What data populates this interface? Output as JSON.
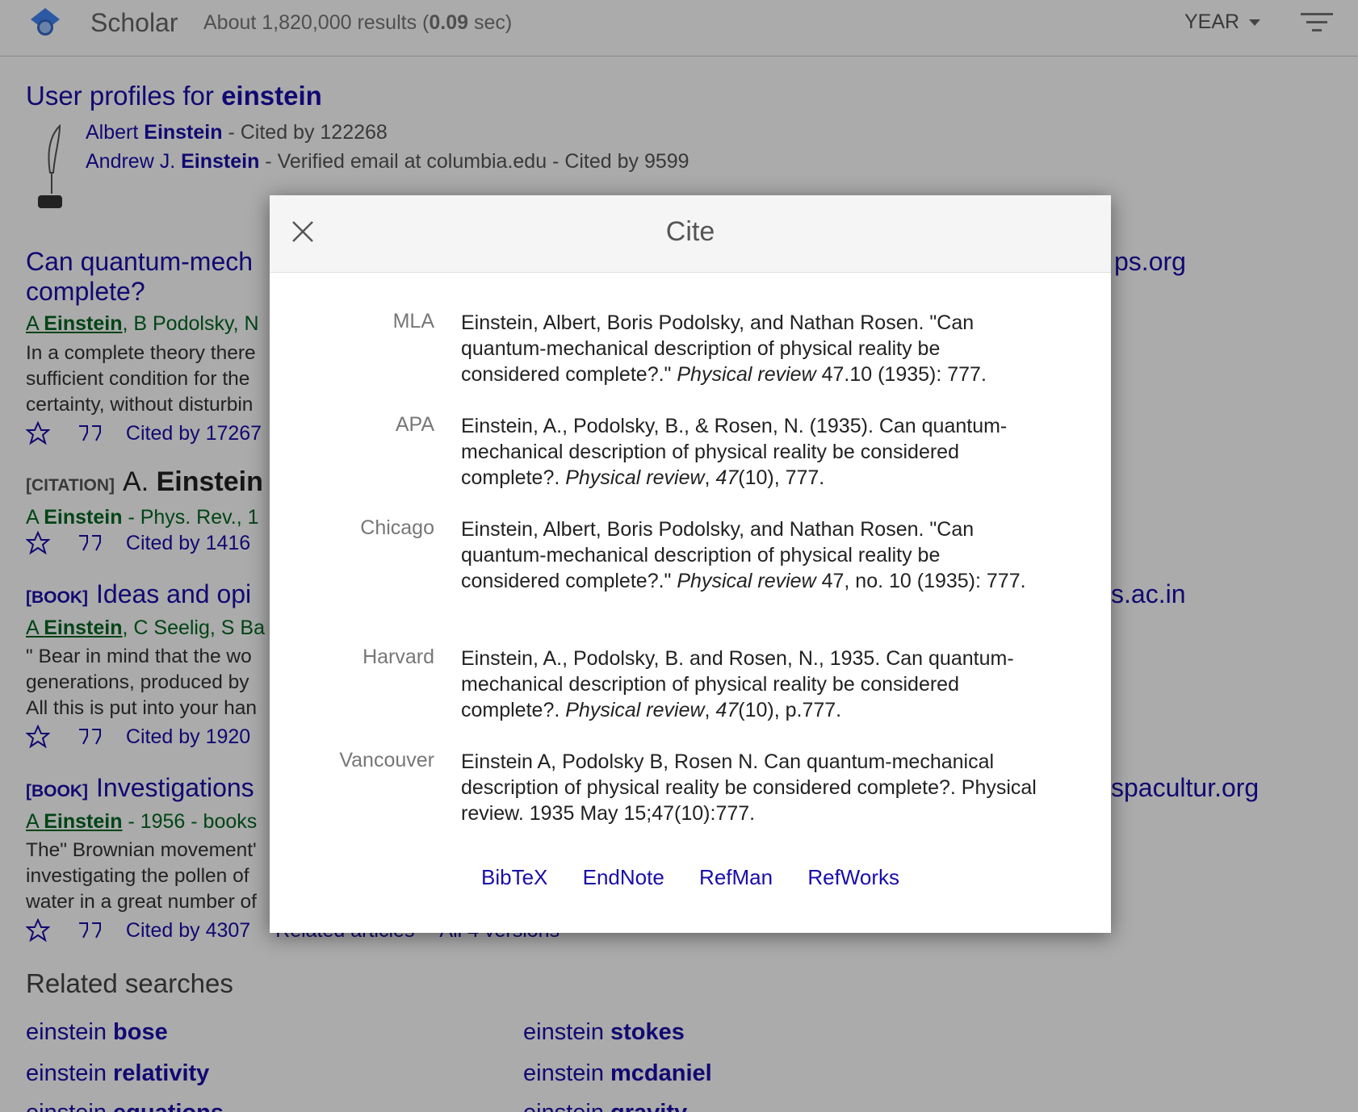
{
  "header": {
    "brand": "Scholar",
    "results_prefix": "About 1,820,000 results (",
    "results_time": "0.09",
    "results_suffix": " sec)",
    "year_label": "YEAR"
  },
  "profiles": {
    "title_prefix": "User profiles for ",
    "title_query": "einstein",
    "items": [
      {
        "first": "Albert ",
        "last": "Einstein",
        "meta": " - Cited by 122268"
      },
      {
        "first": "Andrew J. ",
        "last": "Einstein",
        "meta": " - Verified email at columbia.edu - Cited by 9599"
      }
    ]
  },
  "results": [
    {
      "title_line1": "Can quantum-mech",
      "title_line2": "complete?",
      "side_link": "ps.org",
      "authors_a": "A ",
      "authors_b": "Einstein",
      "authors_rest": ", B Podolsky, N",
      "snippet": [
        "In a complete theory there",
        "sufficient condition for the",
        "certainty, without disturbin"
      ],
      "cited": "Cited by 17267"
    },
    {
      "tag": "[CITATION]",
      "title_a": "A. ",
      "title_b": "Einstein",
      "authors_a": "A ",
      "authors_b": "Einstein",
      "authors_rest": " - Phys. Rev., 1",
      "cited": "Cited by 1416"
    },
    {
      "tag": "[BOOK]",
      "title": "Ideas and opi",
      "side_link": "s.ac.in",
      "authors_a": "A ",
      "authors_b": "Einstein",
      "authors_rest": ", C Seelig, S Ba",
      "snippet": [
        "\" Bear in mind that the wo",
        "generations, produced by",
        "All this is put into your han"
      ],
      "cited": "Cited by 1920"
    },
    {
      "tag": "[BOOK]",
      "title": "Investigations",
      "side_link": "spacultur.org",
      "authors_a": "A ",
      "authors_b": "Einstein",
      "authors_rest": " - 1956 - books",
      "snippet": [
        "The\" Brownian movement'",
        "investigating the pollen of",
        "water in a great number of"
      ],
      "cited": "Cited by 4307",
      "related": "Related articles",
      "versions": "All 4 versions"
    }
  ],
  "related_searches": {
    "title": "Related searches",
    "items": [
      {
        "base": "einstein ",
        "bold": "bose"
      },
      {
        "base": "einstein ",
        "bold": "stokes"
      },
      {
        "base": "einstein ",
        "bold": "relativity"
      },
      {
        "base": "einstein ",
        "bold": "mcdaniel"
      },
      {
        "base": "einstein ",
        "bold": "equations"
      },
      {
        "base": "einstein ",
        "bold": "gravity"
      }
    ]
  },
  "modal": {
    "title": "Cite",
    "citations": [
      {
        "style": "MLA",
        "pre": "Einstein, Albert, Boris Podolsky, and Nathan Rosen. \"Can quantum-mechanical description of physical reality be considered complete?.\" ",
        "journal": "Physical review",
        "post": " 47.10 (1935): 777."
      },
      {
        "style": "APA",
        "pre": "Einstein, A., Podolsky, B., & Rosen, N. (1935). Can quantum-mechanical description of physical reality be considered complete?. ",
        "journal": "Physical review",
        "mid": ", ",
        "volume": "47",
        "post": "(10), 777."
      },
      {
        "style": "Chicago",
        "pre": "Einstein, Albert, Boris Podolsky, and Nathan Rosen. \"Can quantum-mechanical description of physical reality be considered complete?.\" ",
        "journal": "Physical review",
        "post": " 47, no. 10 (1935): 777."
      },
      {
        "style": "Harvard",
        "pre": "Einstein, A., Podolsky, B. and Rosen, N., 1935. Can quantum-mechanical description of physical reality be considered complete?. ",
        "journal": "Physical review",
        "mid": ", ",
        "volume": "47",
        "post": "(10), p.777."
      },
      {
        "style": "Vancouver",
        "pre": "Einstein A, Podolsky B, Rosen N. Can quantum-mechanical description of physical reality be considered complete?. Physical review. 1935 May 15;47(10):777."
      }
    ],
    "exports": [
      "BibTeX",
      "EndNote",
      "RefMan",
      "RefWorks"
    ]
  }
}
